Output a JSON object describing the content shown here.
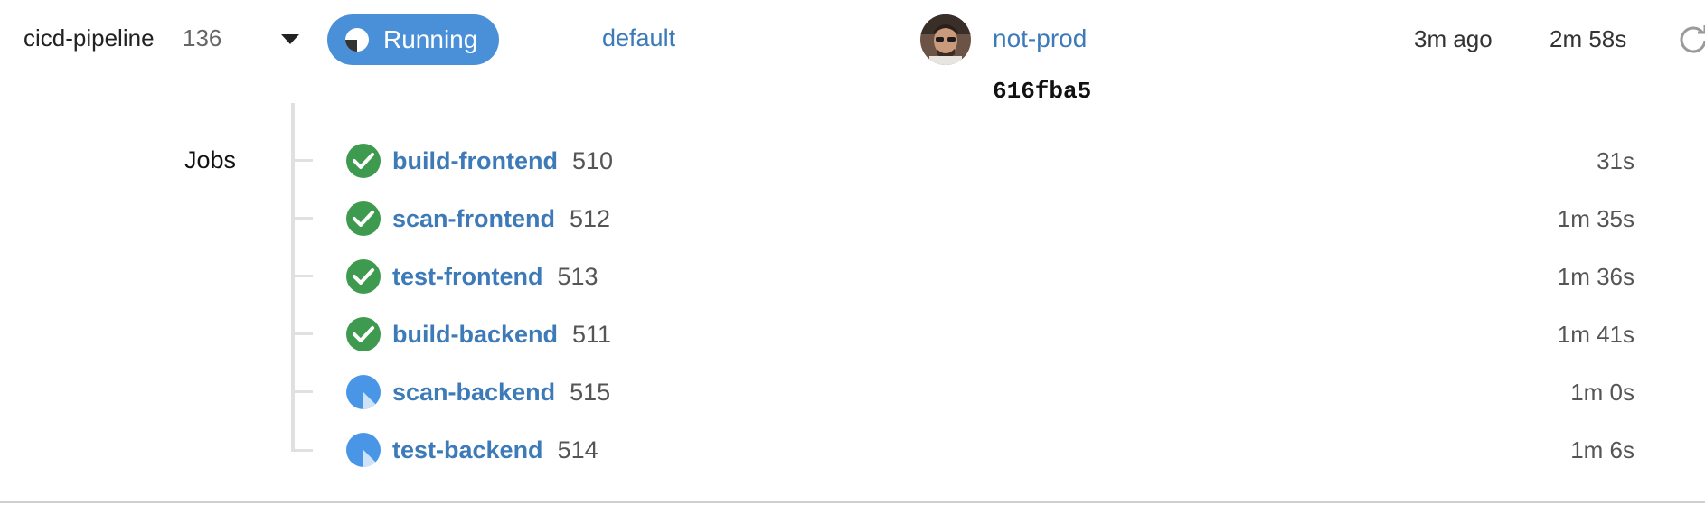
{
  "pipeline": {
    "name": "cicd-pipeline",
    "run_number": "136",
    "status": "Running",
    "branch": "default",
    "deploy_target": "not-prod",
    "commit": "616fba5",
    "started": "3m ago",
    "duration": "2m 58s"
  },
  "jobs_section": {
    "label": "Jobs",
    "jobs": [
      {
        "name": "build-frontend",
        "id": "510",
        "duration": "31s",
        "status": "success"
      },
      {
        "name": "scan-frontend",
        "id": "512",
        "duration": "1m 35s",
        "status": "success"
      },
      {
        "name": "test-frontend",
        "id": "513",
        "duration": "1m 36s",
        "status": "success"
      },
      {
        "name": "build-backend",
        "id": "511",
        "duration": "1m 41s",
        "status": "success"
      },
      {
        "name": "scan-backend",
        "id": "515",
        "duration": "1m 0s",
        "status": "running"
      },
      {
        "name": "test-backend",
        "id": "514",
        "duration": "1m 6s",
        "status": "running"
      }
    ]
  },
  "icons": {
    "status_pill": "running-pie-icon",
    "expand": "chevron-down-icon",
    "refresh": "refresh-icon",
    "success": "check-circle-icon",
    "running": "running-pie-icon"
  },
  "colors": {
    "link": "#3d7ab8",
    "running_pill": "#4a90d9",
    "success": "#3e9a4f",
    "running": "#4a96e6"
  }
}
